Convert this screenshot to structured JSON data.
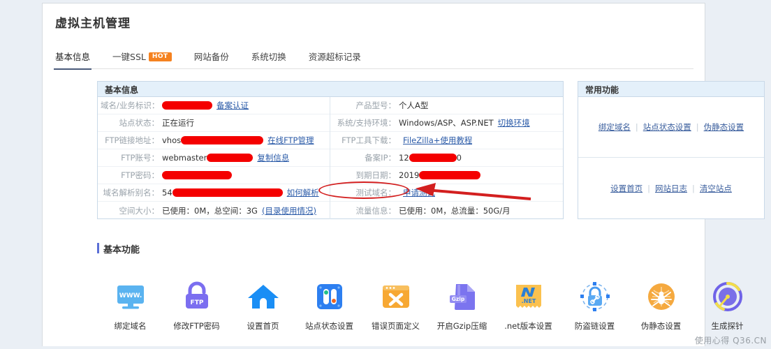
{
  "page": {
    "title": "虚拟主机管理",
    "watermark": "使用心得 Q36.CN",
    "accent_color": "#4a5a7a",
    "badge_color": "#f58220",
    "link_color": "#2b5ba8",
    "redact_color": "#f40000",
    "annotation_color": "#d31f1f"
  },
  "tabs": [
    {
      "label": "基本信息",
      "active": true,
      "badge": ""
    },
    {
      "label": "一键SSL",
      "active": false,
      "badge": "HOT"
    },
    {
      "label": "网站备份",
      "active": false,
      "badge": ""
    },
    {
      "label": "系统切换",
      "active": false,
      "badge": ""
    },
    {
      "label": "资源超标记录",
      "active": false,
      "badge": ""
    }
  ],
  "info_panel": {
    "title": "基本信息",
    "left_rows": [
      {
        "label": "域名/业务标识：",
        "value": "",
        "redact_width": 72,
        "link": "备案认证"
      },
      {
        "label": "站点状态：",
        "value": "正在运行",
        "redact_width": 0,
        "link": ""
      },
      {
        "label": "FTP链接地址：",
        "value": "vhos",
        "redact_width": 118,
        "link": "在线FTP管理"
      },
      {
        "label": "FTP账号：",
        "value": "webmaster",
        "redact_width": 66,
        "link": "复制信息"
      },
      {
        "label": "FTP密码：",
        "value": "",
        "redact_width": 100,
        "link": ""
      },
      {
        "label": "域名解析别名：",
        "value": "54",
        "redact_width": 158,
        "link": "如何解析"
      },
      {
        "label": "空间大小：",
        "value": "已使用：0M，总空间：3G",
        "redact_width": 0,
        "link": "(目录使用情况)"
      }
    ],
    "right_rows": [
      {
        "label": "产品型号：",
        "value": "个人A型",
        "redact_width": 0,
        "link": ""
      },
      {
        "label": "系统/支持环境：",
        "value": "Windows/ASP、ASP.NET",
        "redact_width": 0,
        "link": "切换环境"
      },
      {
        "label": "FTP工具下载：",
        "value": "",
        "redact_width": 0,
        "link": "FileZilla+使用教程"
      },
      {
        "label": "备案IP：",
        "value": "12",
        "redact_width": 68,
        "value_after": "0",
        "link": ""
      },
      {
        "label": "到期日期：",
        "value": "2019",
        "redact_width": 88,
        "link": ""
      },
      {
        "label": "测试域名：",
        "value": "",
        "redact_width": 0,
        "link": "申请测试"
      },
      {
        "label": "流量信息：",
        "value": "已使用：0M，总流量：50G/月",
        "redact_width": 0,
        "link": ""
      }
    ]
  },
  "func_panel": {
    "title": "常用功能",
    "group_one": [
      "绑定域名",
      "站点状态设置",
      "伪静态设置"
    ],
    "group_two": [
      "设置首页",
      "网站日志",
      "清空站点"
    ],
    "separator": "|"
  },
  "basic_functions": {
    "title": "基本功能",
    "items": [
      {
        "label": "绑定域名",
        "icon": "monitor-www-icon",
        "text": "WWW."
      },
      {
        "label": "修改FTP密码",
        "icon": "lock-ftp-icon",
        "text": "FTP"
      },
      {
        "label": "设置首页",
        "icon": "home-icon",
        "text": ""
      },
      {
        "label": "站点状态设置",
        "icon": "toggle-status-icon",
        "text": ""
      },
      {
        "label": "错误页面定义",
        "icon": "window-error-icon",
        "text": ""
      },
      {
        "label": "开启Gzip压缩",
        "icon": "gzip-file-icon",
        "text": "Gzip"
      },
      {
        "label": ".net版本设置",
        "icon": "dotnet-icon",
        "text": ".NET"
      },
      {
        "label": "防盗链设置",
        "icon": "hotlink-lock-icon",
        "text": ""
      },
      {
        "label": "伪静态设置",
        "icon": "spider-icon",
        "text": ""
      },
      {
        "label": "生成探针",
        "icon": "gauge-probe-icon",
        "text": ""
      }
    ]
  }
}
